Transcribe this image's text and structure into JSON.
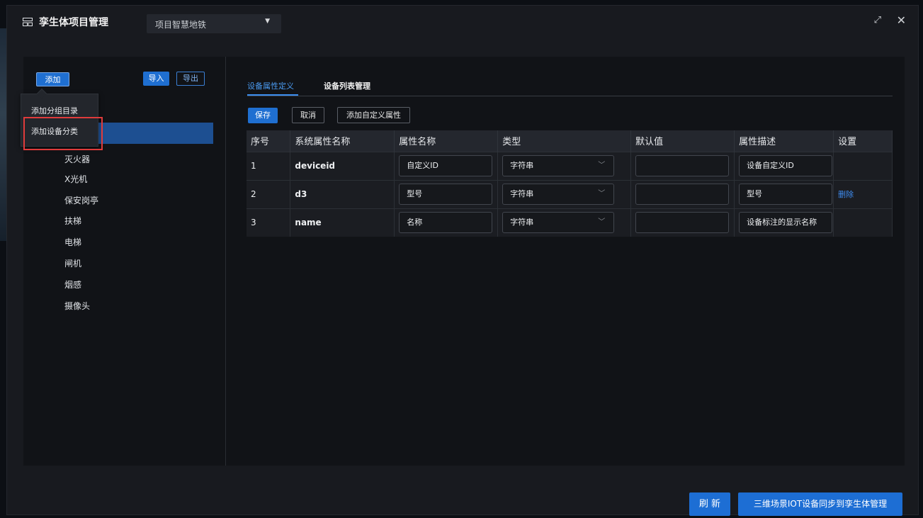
{
  "app": {
    "title": "孪生体项目管理",
    "project_select": "项目智慧地铁"
  },
  "left": {
    "add_label": "添加",
    "import_label": "导入",
    "export_label": "导出",
    "dropdown": [
      "添加分组目录",
      "添加设备分类"
    ],
    "tree": [
      "灭火器",
      "X光机",
      "保安岗亭",
      "扶梯",
      "电梯",
      "闸机",
      "烟感",
      "摄像头"
    ]
  },
  "tabs": [
    "设备属性定义",
    "设备列表管理"
  ],
  "actions": {
    "save": "保存",
    "cancel": "取消",
    "add_custom": "添加自定义属性"
  },
  "table": {
    "headers": [
      "序号",
      "系统属性名称",
      "属性名称",
      "类型",
      "默认值",
      "属性描述",
      "设置"
    ],
    "rows": [
      {
        "no": "1",
        "system_name": "deviceid",
        "name": "自定义ID",
        "type": "字符串",
        "default": "",
        "desc": "设备自定义ID",
        "setting": ""
      },
      {
        "no": "2",
        "system_name": "d3",
        "name": "型号",
        "type": "字符串",
        "default": "",
        "desc": "型号",
        "setting": "删除"
      },
      {
        "no": "3",
        "system_name": "name",
        "name": "名称",
        "type": "字符串",
        "default": "",
        "desc": "设备标注的显示名称",
        "setting": ""
      }
    ]
  },
  "footer": {
    "refresh": "刷 新",
    "sync": "三维场景IOT设备同步到孪生体管理"
  },
  "colors": {
    "accent": "#1f6fd1",
    "highlight_box": "#e03b3b",
    "background": "#181a1f"
  }
}
